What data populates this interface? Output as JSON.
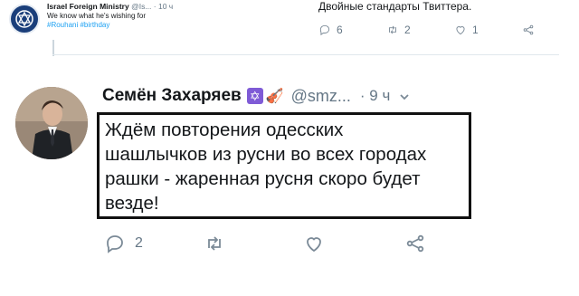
{
  "embedded_tweet": {
    "author_name": "Israel Foreign Ministry",
    "author_handle": "@Is...",
    "time": "· 10 ч",
    "text": "We know what he's wishing for",
    "hashtags": "#Rouhani #birthday"
  },
  "previous_tweet": {
    "text": "Двойные стандарты Твиттера.",
    "replies": "6",
    "retweets": "2",
    "likes": "1"
  },
  "tweet": {
    "author_name": "Семён Захаряев",
    "badge_star": "✡",
    "badge_violin": "🎻",
    "handle": "@smz...",
    "time": "· 9 ч",
    "text_lines": [
      "Ждём повторения одесских",
      "шашлычков из русни во всех городах",
      "рашки - жаренная русня скоро будет",
      "везде!"
    ],
    "replies": "2",
    "retweets": "",
    "likes": ""
  },
  "icons": {
    "reply": "reply-icon",
    "retweet": "retweet-icon",
    "like": "heart-icon",
    "share": "share-icon",
    "more": "chevron-down-icon"
  },
  "colors": {
    "text": "#14171a",
    "muted": "#657786",
    "link": "#1da1f2",
    "badge_purple": "#7f5bd6"
  }
}
